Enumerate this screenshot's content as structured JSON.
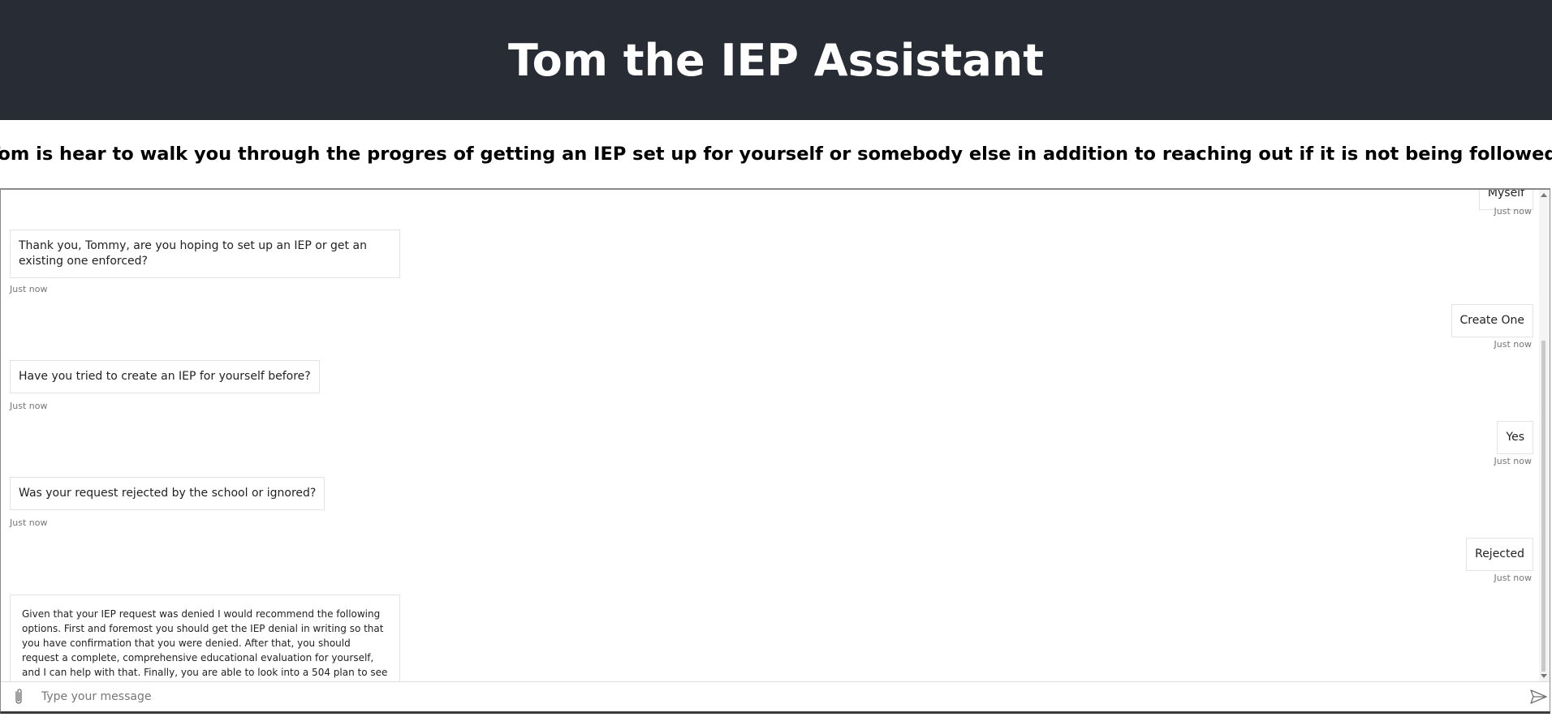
{
  "header": {
    "title": "Tom the IEP Assistant"
  },
  "subtitle": "Tom is hear to walk you through the progres of getting an IEP set up for yourself or somebody else in addition to reaching out if it is not being followed.",
  "chat": {
    "messages": [
      {
        "role": "user",
        "text": "Myself",
        "time": "Just now"
      },
      {
        "role": "bot",
        "text": "Thank you, Tommy, are you hoping to set up an IEP or get an existing one enforced?",
        "time": "Just now"
      },
      {
        "role": "user",
        "text": "Create One",
        "time": "Just now"
      },
      {
        "role": "bot",
        "text": "Have you tried to create an IEP for yourself before?",
        "time": "Just now"
      },
      {
        "role": "user",
        "text": "Yes",
        "time": "Just now"
      },
      {
        "role": "bot",
        "text": "Was your request rejected by the school or ignored?",
        "time": "Just now"
      },
      {
        "role": "user",
        "text": "Rejected",
        "time": "Just now"
      },
      {
        "role": "bot",
        "text": "Given that your IEP request was denied I would recommend the following options. First and foremost you should get the IEP denial in writing so that you have confirmation that you were denied. After that, you should request a complete, comprehensive educational evaluation for yourself, and I can help with that. Finally, you are able to look into a 504 plan to see if it could be a",
        "time": ""
      }
    ]
  },
  "input": {
    "placeholder": "Type your message",
    "value": ""
  },
  "icons": {
    "attach": "paperclip-icon",
    "send": "send-icon"
  },
  "colors": {
    "header_bg": "#282c34",
    "header_text": "#ffffff",
    "bubble_border": "#e3e3e3",
    "timestamp": "#767676"
  }
}
